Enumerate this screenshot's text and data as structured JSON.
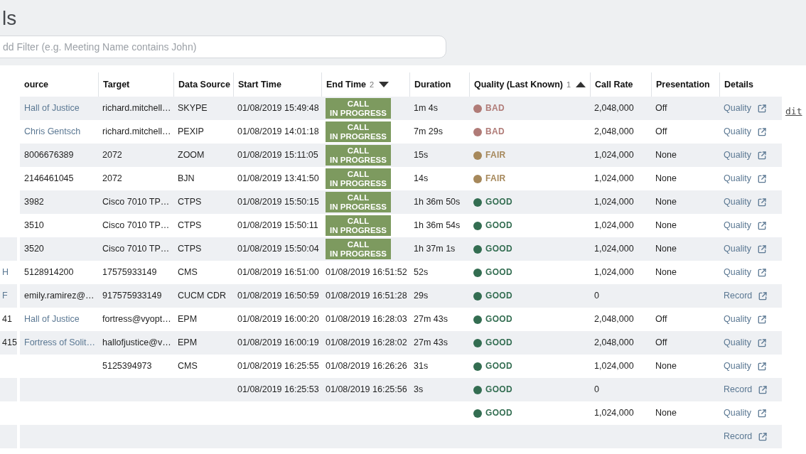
{
  "page": {
    "title": "ls"
  },
  "filter": {
    "placeholder": "dd Filter (e.g. Meeting Name contains John)"
  },
  "edit_link": "dit",
  "background_table": {
    "cells": [
      {
        "text": "H",
        "kind": "link"
      },
      {
        "text": "F",
        "kind": "link"
      },
      {
        "text": "41",
        "kind": "plain"
      },
      {
        "text": "415",
        "kind": "plain"
      }
    ]
  },
  "table": {
    "columns": [
      {
        "label": "ource"
      },
      {
        "label": "Target"
      },
      {
        "label": "Data Source"
      },
      {
        "label": "Start Time"
      },
      {
        "label": "End Time",
        "sort_order": "2",
        "sort_descending": true
      },
      {
        "label": "Duration"
      },
      {
        "label": "Quality (Last Known)",
        "sort_order": "1",
        "sort_descending": false
      },
      {
        "label": "Call Rate"
      },
      {
        "label": "Presentation"
      },
      {
        "label": "Details"
      }
    ],
    "rows": [
      {
        "source": {
          "text": "Hall of Justice",
          "kind": "link"
        },
        "target": "richard.mitchell…",
        "data_source": "SKYPE",
        "start_time": "01/08/2019 15:49:48",
        "end_time": {
          "kind": "badge",
          "text": "CALL\nIN PROGRESS"
        },
        "duration": "1m 4s",
        "quality": {
          "label": "BAD",
          "color": "#b07b77"
        },
        "call_rate": "2,048,000",
        "presentation": "Off",
        "details": "Quality"
      },
      {
        "source": {
          "text": "Chris Gentsch",
          "kind": "link"
        },
        "target": "richard.mitchell…",
        "data_source": "PEXIP",
        "start_time": "01/08/2019 14:01:18",
        "end_time": {
          "kind": "badge",
          "text": "CALL\nIN PROGRESS"
        },
        "duration": "7m 29s",
        "quality": {
          "label": "BAD",
          "color": "#b07b77"
        },
        "call_rate": "2,048,000",
        "presentation": "Off",
        "details": "Quality"
      },
      {
        "source": {
          "text": "8006676389",
          "kind": "plain"
        },
        "target": "2072",
        "data_source": "ZOOM",
        "start_time": "01/08/2019 15:11:05",
        "end_time": {
          "kind": "badge",
          "text": "CALL\nIN PROGRESS"
        },
        "duration": "15s",
        "quality": {
          "label": "FAIR",
          "color": "#a6885b"
        },
        "call_rate": "1,024,000",
        "presentation": "None",
        "details": "Quality"
      },
      {
        "source": {
          "text": "2146461045",
          "kind": "plain"
        },
        "target": "2072",
        "data_source": "BJN",
        "start_time": "01/08/2019 13:41:50",
        "end_time": {
          "kind": "badge",
          "text": "CALL\nIN PROGRESS"
        },
        "duration": "14s",
        "quality": {
          "label": "FAIR",
          "color": "#a6885b"
        },
        "call_rate": "1,024,000",
        "presentation": "None",
        "details": "Quality"
      },
      {
        "source": {
          "text": "3982",
          "kind": "plain"
        },
        "target": "Cisco 7010 TP…",
        "data_source": "CTPS",
        "start_time": "01/08/2019 15:50:15",
        "end_time": {
          "kind": "badge",
          "text": "CALL\nIN PROGRESS"
        },
        "duration": "1h 36m 50s",
        "quality": {
          "label": "GOOD",
          "color": "#336d51"
        },
        "call_rate": "1,024,000",
        "presentation": "None",
        "details": "Quality"
      },
      {
        "source": {
          "text": "3510",
          "kind": "plain"
        },
        "target": "Cisco 7010 TP…",
        "data_source": "CTPS",
        "start_time": "01/08/2019 15:50:11",
        "end_time": {
          "kind": "badge",
          "text": "CALL\nIN PROGRESS"
        },
        "duration": "1h 36m 54s",
        "quality": {
          "label": "GOOD",
          "color": "#336d51"
        },
        "call_rate": "1,024,000",
        "presentation": "None",
        "details": "Quality"
      },
      {
        "source": {
          "text": "3520",
          "kind": "plain"
        },
        "target": "Cisco 7010 TP…",
        "data_source": "CTPS",
        "start_time": "01/08/2019 15:50:04",
        "end_time": {
          "kind": "badge",
          "text": "CALL\nIN PROGRESS"
        },
        "duration": "1h 37m 1s",
        "quality": {
          "label": "GOOD",
          "color": "#336d51"
        },
        "call_rate": "1,024,000",
        "presentation": "None",
        "details": "Quality"
      },
      {
        "source": {
          "text": "5128914200",
          "kind": "plain"
        },
        "target": "17575933149",
        "data_source": "CMS",
        "start_time": "01/08/2019 16:51:00",
        "end_time": {
          "kind": "time",
          "text": "01/08/2019 16:51:52"
        },
        "duration": "52s",
        "quality": {
          "label": "GOOD",
          "color": "#336d51"
        },
        "call_rate": "1,024,000",
        "presentation": "None",
        "details": "Quality"
      },
      {
        "source": {
          "text": "emily.ramirez@…",
          "kind": "plain"
        },
        "target": "917575933149",
        "data_source": "CUCM CDR",
        "start_time": "01/08/2019 16:50:59",
        "end_time": {
          "kind": "time",
          "text": "01/08/2019 16:51:28"
        },
        "duration": "29s",
        "quality": {
          "label": "GOOD",
          "color": "#336d51"
        },
        "call_rate": "0",
        "details": "Record"
      },
      {
        "source": {
          "text": "Hall of Justice",
          "kind": "link"
        },
        "target": "fortress@vyopt…",
        "data_source": "EPM",
        "start_time": "01/08/2019 16:00:20",
        "end_time": {
          "kind": "time",
          "text": "01/08/2019 16:28:03"
        },
        "duration": "27m 43s",
        "quality": {
          "label": "GOOD",
          "color": "#336d51"
        },
        "call_rate": "2,048,000",
        "presentation": "Off",
        "details": "Quality"
      },
      {
        "source": {
          "text": "Fortress of Solit…",
          "kind": "link"
        },
        "target": "hallofjustice@v…",
        "data_source": "EPM",
        "start_time": "01/08/2019 16:00:19",
        "end_time": {
          "kind": "time",
          "text": "01/08/2019 16:28:02"
        },
        "duration": "27m 43s",
        "quality": {
          "label": "GOOD",
          "color": "#336d51"
        },
        "call_rate": "2,048,000",
        "presentation": "Off",
        "details": "Quality"
      },
      {
        "target": "5125394973",
        "data_source": "CMS",
        "start_time": "01/08/2019 16:25:55",
        "end_time": {
          "kind": "time",
          "text": "01/08/2019 16:26:26"
        },
        "duration": "31s",
        "quality": {
          "label": "GOOD",
          "color": "#336d51"
        },
        "call_rate": "1,024,000",
        "presentation": "None",
        "details": "Quality"
      },
      {
        "start_time": "01/08/2019 16:25:53",
        "end_time": {
          "kind": "time",
          "text": "01/08/2019 16:25:56"
        },
        "duration": "3s",
        "quality": {
          "label": "GOOD",
          "color": "#336d51"
        },
        "call_rate": "0",
        "details": "Record"
      },
      {
        "quality": {
          "label": "GOOD",
          "color": "#336d51"
        },
        "call_rate": "1,024,000",
        "presentation": "None",
        "details": "Quality"
      },
      {
        "details": "Record"
      }
    ]
  }
}
